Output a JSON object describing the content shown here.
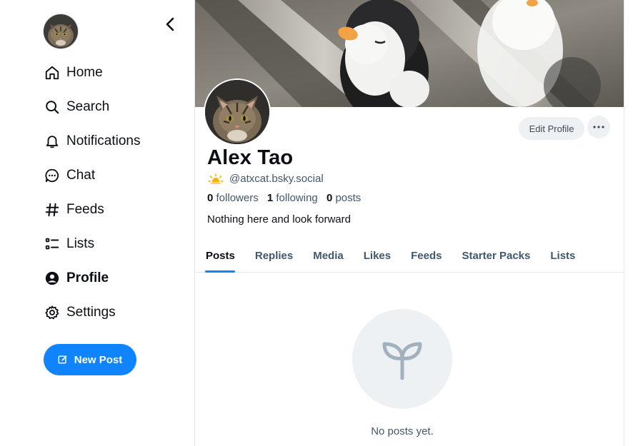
{
  "sidebar": {
    "avatar_icon": "cat-avatar",
    "collapse_icon": "chevron-left-icon",
    "items": [
      {
        "label": "Home",
        "icon": "home-icon"
      },
      {
        "label": "Search",
        "icon": "search-icon"
      },
      {
        "label": "Notifications",
        "icon": "bell-icon"
      },
      {
        "label": "Chat",
        "icon": "chat-icon"
      },
      {
        "label": "Feeds",
        "icon": "hash-icon"
      },
      {
        "label": "Lists",
        "icon": "list-icon"
      },
      {
        "label": "Profile",
        "icon": "profile-icon"
      },
      {
        "label": "Settings",
        "icon": "gear-icon"
      }
    ],
    "new_post_label": "New Post"
  },
  "profile": {
    "display_name": "Alex Tao",
    "handle": "@atxcat.bsky.social",
    "followers_count": "0",
    "followers_label": "followers",
    "following_count": "1",
    "following_label": "following",
    "posts_count": "0",
    "posts_label": "posts",
    "bio": "Nothing here and look forward",
    "edit_label": "Edit Profile"
  },
  "tabs": [
    "Posts",
    "Replies",
    "Media",
    "Likes",
    "Feeds",
    "Starter Packs",
    "Lists"
  ],
  "active_tab": "Posts",
  "empty_state": {
    "icon": "sprout-icon",
    "text": "No posts yet."
  },
  "colors": {
    "accent": "#1083fe",
    "muted_text": "#42576c",
    "empty_bg": "#eef1f4"
  }
}
